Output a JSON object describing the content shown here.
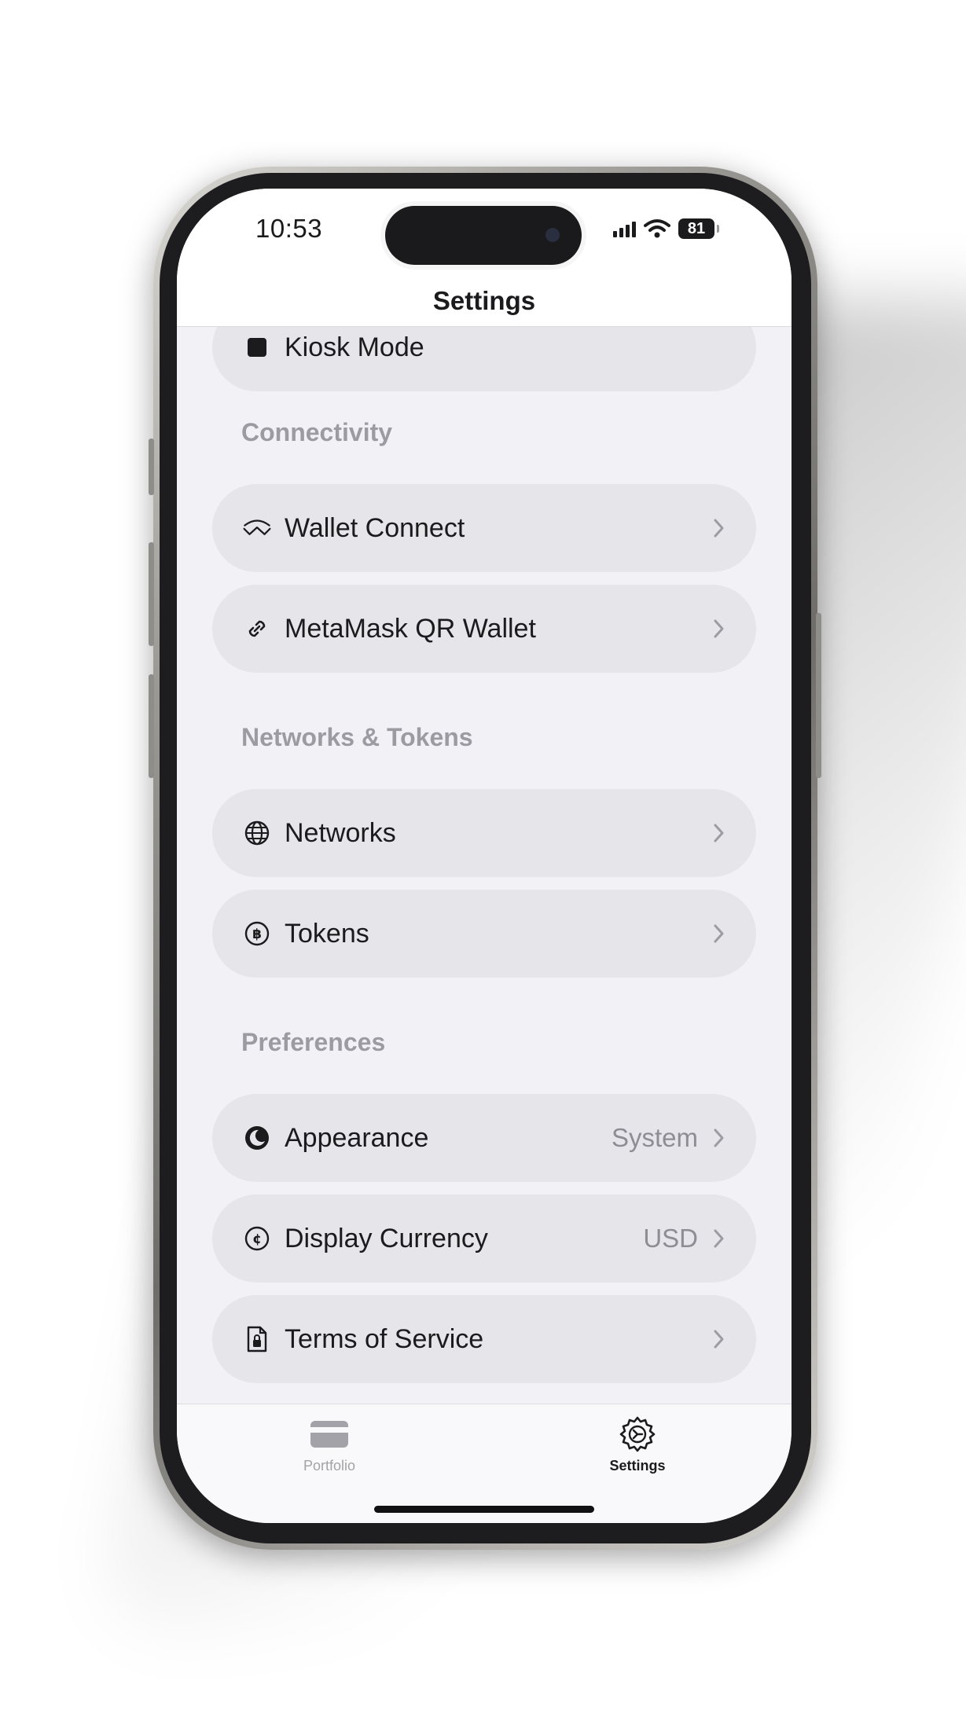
{
  "status_bar": {
    "time": "10:53",
    "battery": "81"
  },
  "nav": {
    "title": "Settings"
  },
  "partial_row": {
    "label": "Kiosk Mode",
    "icon": "kiosk-icon"
  },
  "sections": [
    {
      "header": "Connectivity",
      "rows": [
        {
          "label": "Wallet Connect",
          "icon": "walletconnect-icon",
          "value": ""
        },
        {
          "label": "MetaMask QR Wallet",
          "icon": "link-icon",
          "value": ""
        }
      ]
    },
    {
      "header": "Networks & Tokens",
      "rows": [
        {
          "label": "Networks",
          "icon": "globe-icon",
          "value": ""
        },
        {
          "label": "Tokens",
          "icon": "bitcoin-circle-icon",
          "value": ""
        }
      ]
    },
    {
      "header": "Preferences",
      "rows": [
        {
          "label": "Appearance",
          "icon": "moon-icon",
          "value": "System"
        },
        {
          "label": "Display Currency",
          "icon": "cent-circle-icon",
          "value": "USD"
        },
        {
          "label": "Terms of Service",
          "icon": "document-lock-icon",
          "value": ""
        }
      ]
    }
  ],
  "tab_bar": {
    "tabs": [
      {
        "label": "Portfolio",
        "icon": "card-icon",
        "selected": false
      },
      {
        "label": "Settings",
        "icon": "settings-gear-icon",
        "selected": true
      }
    ]
  },
  "colors": {
    "row_background": "#e5e5ea",
    "screen_background": "#f2f2f6",
    "section_header": "#9b9ba1",
    "text_primary": "#1b1b1d",
    "text_secondary": "#8d8d93"
  }
}
